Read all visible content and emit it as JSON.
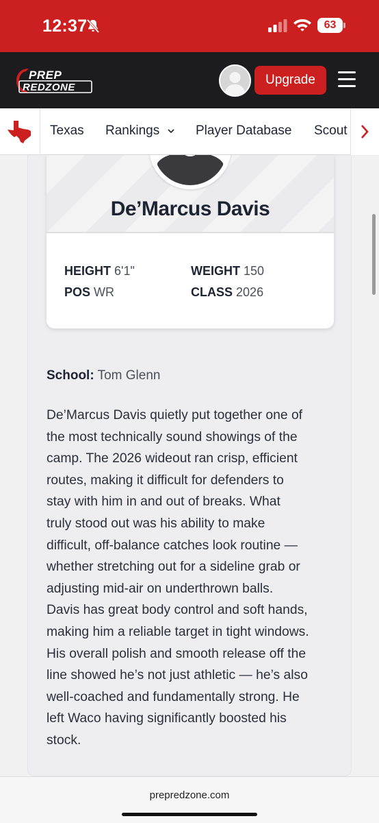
{
  "status_bar": {
    "time": "12:37",
    "battery": "63"
  },
  "header": {
    "logo_line1": "PREP",
    "logo_line2": "REDZONE",
    "upgrade_label": "Upgrade"
  },
  "nav": {
    "items": [
      "Texas",
      "Rankings",
      "Player Database",
      "Scout"
    ]
  },
  "player": {
    "name": "De’Marcus Davis",
    "height_label": "HEIGHT",
    "height": "6'1\"",
    "weight_label": "WEIGHT",
    "weight": "150",
    "pos_label": "POS",
    "pos": "WR",
    "class_label": "CLASS",
    "class": "2026",
    "school_label": "School:",
    "school": "Tom Glenn"
  },
  "bio_lines": [
    "De’Marcus Davis quietly put together one of",
    "the most technically sound showings of the",
    "camp. The 2026 wideout ran crisp, efficient",
    "routes, making it difficult for defenders to",
    "stay with him in and out of breaks. What",
    "truly stood out was his ability to make",
    "difficult, off-balance catches look routine —",
    "whether stretching out for a sideline grab or",
    "adjusting mid-air on underthrown balls.",
    "Davis has great body control and soft hands,",
    "making him a reliable target in tight windows.",
    "His overall polish and smooth release off the",
    "line showed he’s not just athletic — he’s also",
    "well-coached and fundamentally strong. He",
    "left Waco having significantly boosted his",
    "stock."
  ],
  "browser": {
    "url": "prepredzone.com"
  },
  "colors": {
    "brand_red": "#cc1f1f",
    "header_dark": "#1c1c1e",
    "text_dark": "#1d2433"
  }
}
